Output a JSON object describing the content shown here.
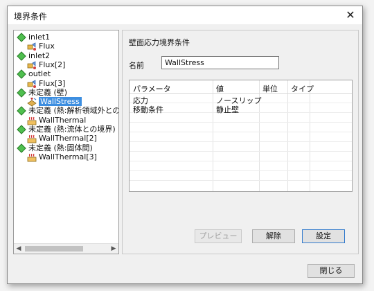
{
  "window": {
    "title": "境界条件"
  },
  "tree": [
    {
      "label": "inlet1",
      "icon": "diamond",
      "sel": false
    },
    {
      "label": "Flux",
      "icon": "flux",
      "sel": false
    },
    {
      "label": "inlet2",
      "icon": "diamond",
      "sel": false
    },
    {
      "label": "Flux[2]",
      "icon": "flux",
      "sel": false
    },
    {
      "label": "outlet",
      "icon": "diamond",
      "sel": false
    },
    {
      "label": "Flux[3]",
      "icon": "flux",
      "sel": false
    },
    {
      "label": "未定義 (壁)",
      "icon": "diamond",
      "sel": false
    },
    {
      "label": "WallStress",
      "icon": "wall-stress",
      "sel": true
    },
    {
      "label": "未定義 (熱:解析領域外との",
      "icon": "diamond",
      "sel": false
    },
    {
      "label": "WallThermal",
      "icon": "thermal",
      "sel": false
    },
    {
      "label": "未定義 (熱:流体との境界)",
      "icon": "diamond",
      "sel": false
    },
    {
      "label": "WallThermal[2]",
      "icon": "thermal",
      "sel": false
    },
    {
      "label": "未定義 (熱:固体間)",
      "icon": "diamond",
      "sel": false
    },
    {
      "label": "WallThermal[3]",
      "icon": "thermal",
      "sel": false
    }
  ],
  "panel": {
    "title": "壁面応力境界条件",
    "name_label": "名前",
    "name_value": "WallStress"
  },
  "grid": {
    "headers": [
      "パラメータ",
      "値",
      "単位",
      "タイプ"
    ],
    "rows": [
      [
        "応力",
        "ノースリップ",
        "",
        ""
      ],
      [
        "移動条件",
        "静止壁",
        "",
        ""
      ]
    ]
  },
  "buttons": {
    "preview": "プレビュー",
    "release": "解除",
    "set": "設定",
    "close": "閉じる"
  },
  "colors": {
    "selection": "#3d8ee0",
    "diamond": "#3aa63a"
  }
}
